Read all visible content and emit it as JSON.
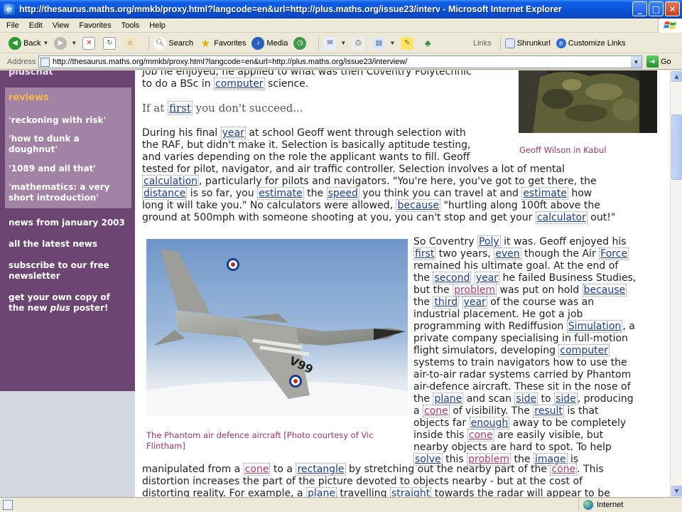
{
  "window": {
    "title": "http://thesaurus.maths.org/mmkb/proxy.html?langcode=en&url=http://plus.maths.org/issue23/interv - Microsoft Internet Explorer",
    "controls": [
      "_",
      "□",
      "✕"
    ]
  },
  "menu": [
    "File",
    "Edit",
    "View",
    "Favorites",
    "Tools",
    "Help"
  ],
  "toolbar": {
    "back": "Back",
    "search": "Search",
    "favorites": "Favorites",
    "media": "Media",
    "links_label": "Links",
    "link1": "Shrunkurl",
    "link2": "Customize Links"
  },
  "address": {
    "label": "Address",
    "url": "http://thesaurus.maths.org/mmkb/proxy.html?langcode=en&url=http://plus.maths.org/issue23/interview/",
    "go": "Go"
  },
  "sidebar": {
    "top_item": "pluschat",
    "section": "reviews",
    "reviews": [
      "'reckoning with risk'",
      "'how to dunk a doughnut'",
      "'1089 and all that'",
      "'mathematics: a very short introduction'"
    ],
    "links": [
      "news from january 2003",
      "all the latest news",
      "subscribe to our free newsletter"
    ],
    "poster_pre": "get your own copy of the new ",
    "poster_em": "plus",
    "poster_post": " poster!"
  },
  "article": {
    "intro_line1": "job he enjoyed, he applied to what was then Coventry Polytechnic",
    "intro_line2_a": "to do a BSc in ",
    "intro_line2_w": "computer",
    "intro_line2_b": " science.",
    "subhead_a": "If at ",
    "subhead_w": "first",
    "subhead_b": " you don't succeed...",
    "p1": [
      [
        {
          "t": "During his final "
        },
        {
          "w": "year"
        },
        {
          "t": " at school Geoff went through selection with"
        }
      ],
      [
        {
          "t": "the RAF, but didn't make it. Selection is basically aptitude testing,"
        }
      ],
      [
        {
          "t": "and varies depending on the role the applicant wants to fill. Geoff"
        }
      ],
      [
        {
          "t": "tested for pilot, navigator, and air traffic controller. Selection involves a lot of mental"
        }
      ],
      [
        {
          "w": "calculation"
        },
        {
          "t": ", particularly for pilots and navigators. \"You're here, you've got to get there, the"
        }
      ],
      [
        {
          "w": "distance"
        },
        {
          "t": " is so far, you "
        },
        {
          "w": "estimate"
        },
        {
          "t": " the "
        },
        {
          "w": "speed"
        },
        {
          "t": " you think you can travel at and "
        },
        {
          "w": "estimate"
        },
        {
          "t": " how"
        }
      ],
      [
        {
          "t": "long it will take you.\" No calculators were allowed, "
        },
        {
          "w": "because"
        },
        {
          "t": " \"hurtling along 100ft above the"
        }
      ],
      [
        {
          "t": "ground at 500mph with someone shooting at you, you can't stop and get your "
        },
        {
          "w": "calculator"
        },
        {
          "t": " out!\""
        }
      ]
    ],
    "p2": [
      [
        {
          "t": "So Coventry "
        },
        {
          "w": "Poly"
        },
        {
          "t": " it was. Geoff enjoyed his"
        }
      ],
      [
        {
          "w": "first"
        },
        {
          "t": " two years, "
        },
        {
          "w": "even"
        },
        {
          "t": " though the Air "
        },
        {
          "w": "Force"
        }
      ],
      [
        {
          "t": "remained his ultimate goal. At the end of"
        }
      ],
      [
        {
          "t": "the "
        },
        {
          "w": "second"
        },
        {
          "t": " "
        },
        {
          "w": "year"
        },
        {
          "t": " he failed Business Studies,"
        }
      ],
      [
        {
          "t": "but the "
        },
        {
          "p": "problem"
        },
        {
          "t": " was put on hold "
        },
        {
          "w": "because"
        }
      ],
      [
        {
          "t": "the "
        },
        {
          "w": "third"
        },
        {
          "t": " "
        },
        {
          "w": "year"
        },
        {
          "t": " of the course was an"
        }
      ],
      [
        {
          "t": "industrial placement. He got a job"
        }
      ],
      [
        {
          "t": "programming with Rediffusion "
        },
        {
          "w": "Simulation"
        },
        {
          "t": ", a"
        }
      ],
      [
        {
          "t": "private company specialising in full-motion"
        }
      ],
      [
        {
          "t": "flight simulators, developing "
        },
        {
          "w": "computer"
        }
      ],
      [
        {
          "t": "systems to train navigators how to use the"
        }
      ],
      [
        {
          "t": "air-to-air radar systems carried by Phantom"
        }
      ],
      [
        {
          "t": "air-defence aircraft. These sit in the nose of"
        }
      ],
      [
        {
          "t": "the "
        },
        {
          "w": "plane"
        },
        {
          "t": " and scan "
        },
        {
          "w": "side"
        },
        {
          "t": " to "
        },
        {
          "w": "side"
        },
        {
          "t": ", producing"
        }
      ],
      [
        {
          "t": "a "
        },
        {
          "p": "cone"
        },
        {
          "t": " of visibility. The "
        },
        {
          "w": "result"
        },
        {
          "t": " is that"
        }
      ],
      [
        {
          "t": "objects far "
        },
        {
          "w": "enough"
        },
        {
          "t": " away to be completely"
        }
      ],
      [
        {
          "t": "inside this "
        },
        {
          "p": "cone"
        },
        {
          "t": " are easily visible, but"
        }
      ],
      [
        {
          "t": "nearby objects are hard to spot. To help"
        }
      ],
      [
        {
          "w": "solve"
        },
        {
          "t": " this "
        },
        {
          "p": "problem"
        },
        {
          "t": " the "
        },
        {
          "w": "image"
        },
        {
          "t": " is"
        }
      ]
    ],
    "p3": [
      [
        {
          "t": "manipulated from a "
        },
        {
          "p": "cone"
        },
        {
          "t": " to a "
        },
        {
          "w": "rectangle"
        },
        {
          "t": " by stretching out the nearby part of the "
        },
        {
          "p": "cone"
        },
        {
          "t": ". This"
        }
      ],
      [
        {
          "t": "distortion increases the part of the picture devoted to objects nearby - but at the cost of"
        }
      ],
      [
        {
          "t": "distorting reality. For example, a "
        },
        {
          "w": "plane"
        },
        {
          "t": " travelling "
        },
        {
          "w": "straight"
        },
        {
          "t": " towards the radar will appear to be"
        }
      ]
    ],
    "caption_soldier": "Geoff Wilson in Kabul",
    "caption_jet_1": "The Phantom air defence aircraft [Photo courtesy of Vic",
    "caption_jet_2": "Flintham]"
  },
  "status": {
    "zone": "Internet"
  }
}
